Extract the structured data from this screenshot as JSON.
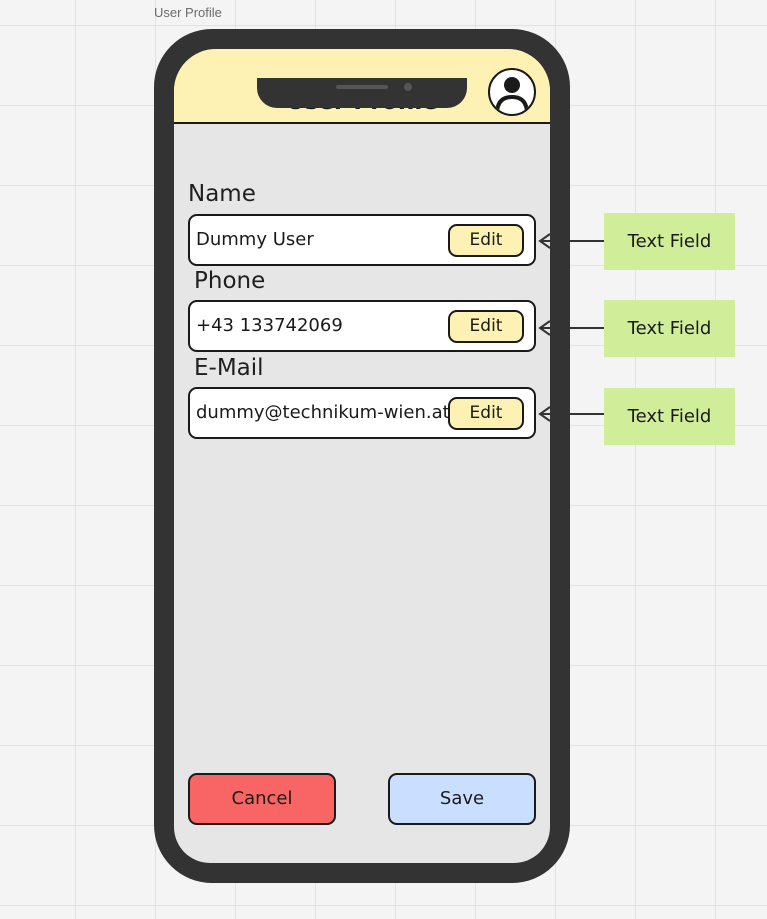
{
  "frame_label": "User Profile",
  "header": {
    "title": "User Profile",
    "avatar_icon": "user-avatar-icon",
    "background_color": "#fdf1b3"
  },
  "fields": [
    {
      "label": "Name",
      "value": "Dummy User",
      "button_label": "Edit"
    },
    {
      "label": "Phone",
      "value": "+43 133742069",
      "button_label": "Edit"
    },
    {
      "label": "E-Mail",
      "value": "dummy@technikum-wien.at",
      "button_label": "Edit"
    }
  ],
  "annotations": [
    {
      "text": "Text Field"
    },
    {
      "text": "Text Field"
    },
    {
      "text": "Text Field"
    }
  ],
  "footer": {
    "cancel_label": "Cancel",
    "save_label": "Save"
  },
  "colors": {
    "cancel": "#f96464",
    "save": "#cadeff",
    "edit": "#fdf1b3",
    "annotation": "#d0ee9a"
  }
}
